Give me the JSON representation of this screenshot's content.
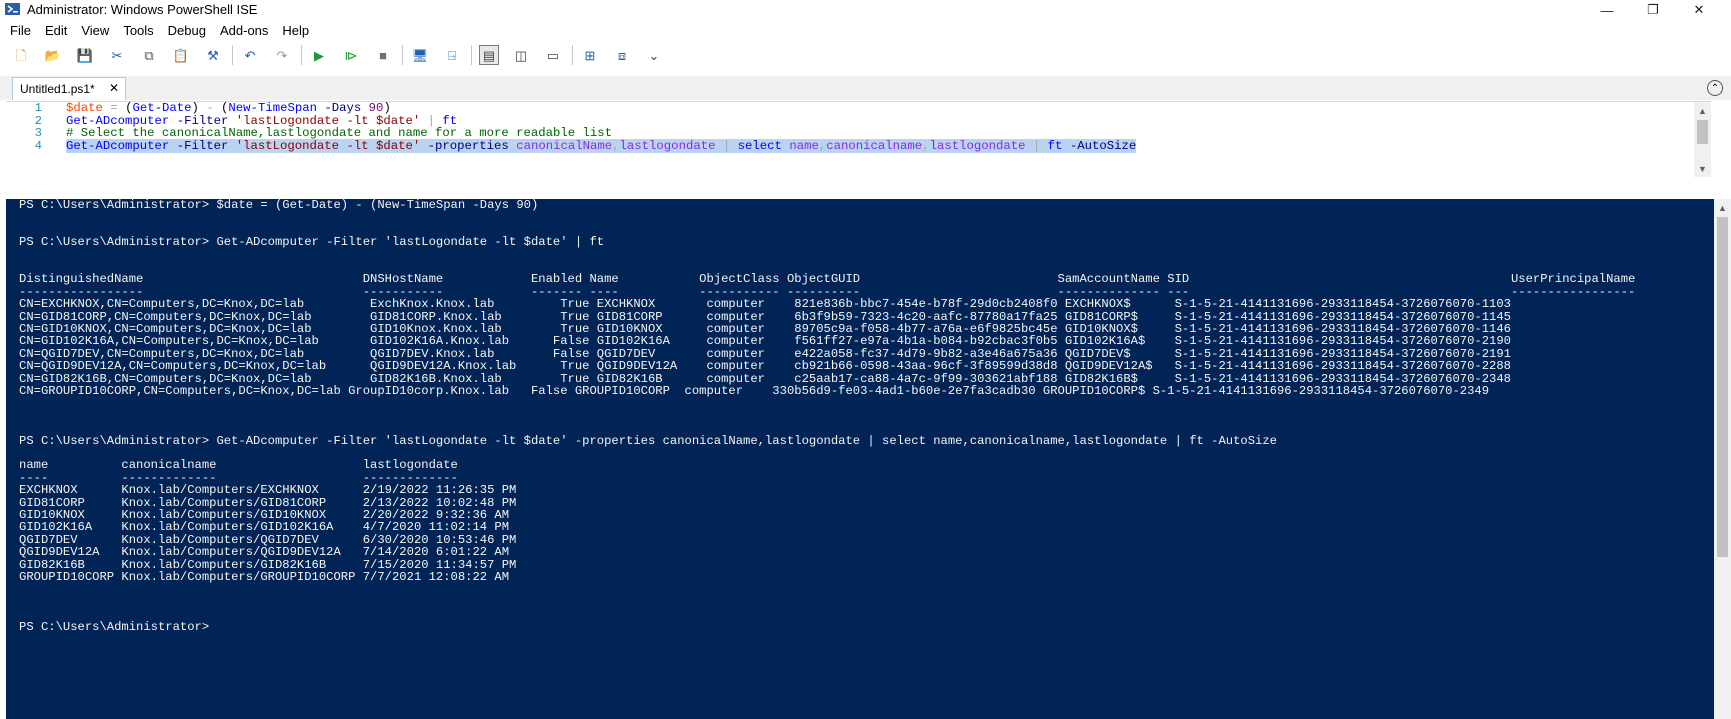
{
  "window": {
    "title": "Administrator: Windows PowerShell ISE",
    "icon": "powershell-ise-icon",
    "controls": [
      "minimize-icon",
      "maximize-icon",
      "close-icon"
    ]
  },
  "menu": [
    "File",
    "Edit",
    "View",
    "Tools",
    "Debug",
    "Add-ons",
    "Help"
  ],
  "toolbar": [
    {
      "name": "new-icon",
      "glyph": "🗋",
      "color": "#c9a227"
    },
    {
      "name": "open-icon",
      "glyph": "📂",
      "color": "#d9a520"
    },
    {
      "name": "save-icon",
      "glyph": "💾",
      "color": "#1f5fae"
    },
    {
      "name": "cut-icon",
      "glyph": "✂",
      "color": "#1f5fae"
    },
    {
      "name": "copy-icon",
      "glyph": "⧉",
      "color": "#555555"
    },
    {
      "name": "paste-icon",
      "glyph": "📋",
      "color": "#7a5b2b"
    },
    {
      "name": "clear-console-icon",
      "glyph": "⚒",
      "color": "#1f5fae"
    },
    {
      "name": "undo-icon",
      "glyph": "↶",
      "color": "#1f5fae"
    },
    {
      "name": "redo-icon",
      "glyph": "↷",
      "color": "#9a9a9a"
    },
    {
      "name": "run-script-icon",
      "glyph": "▶",
      "color": "#1b9b36"
    },
    {
      "name": "run-selection-icon",
      "glyph": "⧐",
      "color": "#1b9b36"
    },
    {
      "name": "stop-icon",
      "glyph": "■",
      "color": "#707070"
    },
    {
      "name": "remote-powershell-icon",
      "glyph": "🖥",
      "color": "#1f5fae"
    },
    {
      "name": "start-powershell-icon",
      "glyph": "⍈",
      "color": "#2d7dd2"
    },
    {
      "name": "show-script-pane-top-icon",
      "glyph": "▤",
      "color": "#444444"
    },
    {
      "name": "show-script-pane-right-icon",
      "glyph": "◫",
      "color": "#444444"
    },
    {
      "name": "show-script-pane-maximized-icon",
      "glyph": "▭",
      "color": "#444444"
    },
    {
      "name": "show-command-window-icon",
      "glyph": "⊞",
      "color": "#1f5fae"
    },
    {
      "name": "show-command-addon-icon",
      "glyph": "⧈",
      "color": "#1f5fae"
    },
    {
      "name": "customize-toolbar-icon",
      "glyph": "⌄",
      "color": "#444444"
    }
  ],
  "tab": {
    "label": "Untitled1.ps1*",
    "close": "✕"
  },
  "collapse_glyph": "⌃",
  "script": {
    "line_numbers": [
      "1",
      "2",
      "3",
      "4"
    ],
    "lines": [
      [
        {
          "t": "$date",
          "c": "c-var"
        },
        {
          "t": " ",
          "c": "c-txt"
        },
        {
          "t": "=",
          "c": "c-op"
        },
        {
          "t": " (",
          "c": "c-txt"
        },
        {
          "t": "Get-Date",
          "c": "c-cmd"
        },
        {
          "t": ") ",
          "c": "c-txt"
        },
        {
          "t": "-",
          "c": "c-op"
        },
        {
          "t": " (",
          "c": "c-txt"
        },
        {
          "t": "New-TimeSpan",
          "c": "c-cmd"
        },
        {
          "t": " ",
          "c": "c-txt"
        },
        {
          "t": "-Days",
          "c": "c-param"
        },
        {
          "t": " ",
          "c": "c-txt"
        },
        {
          "t": "90",
          "c": "c-num"
        },
        {
          "t": ")",
          "c": "c-txt"
        }
      ],
      [
        {
          "t": "Get-ADcomputer",
          "c": "c-cmd"
        },
        {
          "t": " ",
          "c": "c-txt"
        },
        {
          "t": "-Filter",
          "c": "c-param"
        },
        {
          "t": " ",
          "c": "c-txt"
        },
        {
          "t": "'lastLogondate -lt $date'",
          "c": "c-str"
        },
        {
          "t": " ",
          "c": "c-txt"
        },
        {
          "t": "|",
          "c": "c-op"
        },
        {
          "t": " ",
          "c": "c-txt"
        },
        {
          "t": "ft",
          "c": "c-cmd"
        }
      ],
      [
        {
          "t": "# Select the canonicalName,lastlogondate and name for a more readable list",
          "c": "c-cmt"
        }
      ],
      [
        {
          "t": "Get-ADcomputer",
          "c": "c-cmd"
        },
        {
          "t": " ",
          "c": "c-txt"
        },
        {
          "t": "-Filter",
          "c": "c-param"
        },
        {
          "t": " ",
          "c": "c-txt"
        },
        {
          "t": "'lastLogondate -lt $date'",
          "c": "c-str"
        },
        {
          "t": " ",
          "c": "c-txt"
        },
        {
          "t": "-properties",
          "c": "c-param"
        },
        {
          "t": " ",
          "c": "c-txt"
        },
        {
          "t": "canonicalName",
          "c": "c-arg"
        },
        {
          "t": ",",
          "c": "c-op"
        },
        {
          "t": "lastlogondate",
          "c": "c-arg"
        },
        {
          "t": " ",
          "c": "c-txt"
        },
        {
          "t": "|",
          "c": "c-op"
        },
        {
          "t": " ",
          "c": "c-txt"
        },
        {
          "t": "select",
          "c": "c-cmd"
        },
        {
          "t": " ",
          "c": "c-txt"
        },
        {
          "t": "name",
          "c": "c-arg"
        },
        {
          "t": ",",
          "c": "c-op"
        },
        {
          "t": "canonicalname",
          "c": "c-arg"
        },
        {
          "t": ",",
          "c": "c-op"
        },
        {
          "t": "lastlogondate",
          "c": "c-arg"
        },
        {
          "t": " ",
          "c": "c-txt"
        },
        {
          "t": "|",
          "c": "c-op"
        },
        {
          "t": " ",
          "c": "c-txt"
        },
        {
          "t": "ft",
          "c": "c-cmd"
        },
        {
          "t": " ",
          "c": "c-txt"
        },
        {
          "t": "-AutoSize",
          "c": "c-param"
        }
      ]
    ]
  },
  "console": {
    "background": "#012456",
    "lines": [
      "PS C:\\Users\\Administrator> $date = (Get-Date) - (New-TimeSpan -Days 90)",
      "",
      "",
      "PS C:\\Users\\Administrator> Get-ADcomputer -Filter 'lastLogondate -lt $date' | ft",
      "",
      "",
      "DistinguishedName                              DNSHostName            Enabled Name           ObjectClass ObjectGUID                           SamAccountName SID                                            UserPrincipalName",
      "-----------------                              -----------            ------- ----           ----------- ----------                           -------------- ---                                            -----------------",
      "CN=EXCHKNOX,CN=Computers,DC=Knox,DC=lab         ExchKnox.Knox.lab         True EXCHKNOX       computer    821e836b-bbc7-454e-b78f-29d0cb2408f0 EXCHKNOX$      S-1-5-21-4141131696-2933118454-3726076070-1103",
      "CN=GID81CORP,CN=Computers,DC=Knox,DC=lab        GID81CORP.Knox.lab        True GID81CORP      computer    6b3f9b59-7323-4c20-aafc-87780a17fa25 GID81CORP$     S-1-5-21-4141131696-2933118454-3726076070-1145",
      "CN=GID10KNOX,CN=Computers,DC=Knox,DC=lab        GID10Knox.Knox.lab        True GID10KNOX      computer    89705c9a-f058-4b77-a76a-e6f9825bc45e GID10KNOX$     S-1-5-21-4141131696-2933118454-3726076070-1146",
      "CN=GID102K16A,CN=Computers,DC=Knox,DC=lab       GID102K16A.Knox.lab      False GID102K16A     computer    f561ff27-e97a-4b1a-b084-b92cbac3f0b5 GID102K16A$    S-1-5-21-4141131696-2933118454-3726076070-2190",
      "CN=QGID7DEV,CN=Computers,DC=Knox,DC=lab         QGID7DEV.Knox.lab        False QGID7DEV       computer    e422a058-fc37-4d79-9b82-a3e46a675a36 QGID7DEV$      S-1-5-21-4141131696-2933118454-3726076070-2191",
      "CN=QGID9DEV12A,CN=Computers,DC=Knox,DC=lab      QGID9DEV12A.Knox.lab      True QGID9DEV12A    computer    cb921b66-0598-43aa-96cf-3f89599d38d8 QGID9DEV12A$   S-1-5-21-4141131696-2933118454-3726076070-2288",
      "CN=GID82K16B,CN=Computers,DC=Knox,DC=lab        GID82K16B.Knox.lab        True GID82K16B      computer    c25aab17-ca88-4a7c-9f99-303621abf188 GID82K16B$     S-1-5-21-4141131696-2933118454-3726076070-2348",
      "CN=GROUPID10CORP,CN=Computers,DC=Knox,DC=lab GroupID10corp.Knox.lab   False GROUPID10CORP  computer    330b56d9-fe03-4ad1-b60e-2e7fa3cadb30 GROUPID10CORP$ S-1-5-21-4141131696-2933118454-3726076070-2349",
      "",
      "",
      "",
      "PS C:\\Users\\Administrator> Get-ADcomputer -Filter 'lastLogondate -lt $date' -properties canonicalName,lastlogondate | select name,canonicalname,lastlogondate | ft -AutoSize",
      "",
      "name          canonicalname                    lastlogondate",
      "----          -------------                    -------------",
      "EXCHKNOX      Knox.lab/Computers/EXCHKNOX      2/19/2022 11:26:35 PM",
      "GID81CORP     Knox.lab/Computers/GID81CORP     2/13/2022 10:02:48 PM",
      "GID10KNOX     Knox.lab/Computers/GID10KNOX     2/20/2022 9:32:36 AM",
      "GID102K16A    Knox.lab/Computers/GID102K16A    4/7/2020 11:02:14 PM",
      "QGID7DEV      Knox.lab/Computers/QGID7DEV      6/30/2020 10:53:46 PM",
      "QGID9DEV12A   Knox.lab/Computers/QGID9DEV12A   7/14/2020 6:01:22 AM",
      "GID82K16B     Knox.lab/Computers/GID82K16B     7/15/2020 11:34:57 PM",
      "GROUPID10CORP Knox.lab/Computers/GROUPID10CORP 7/7/2021 12:08:22 AM",
      "",
      "",
      "",
      "PS C:\\Users\\Administrator> "
    ]
  }
}
